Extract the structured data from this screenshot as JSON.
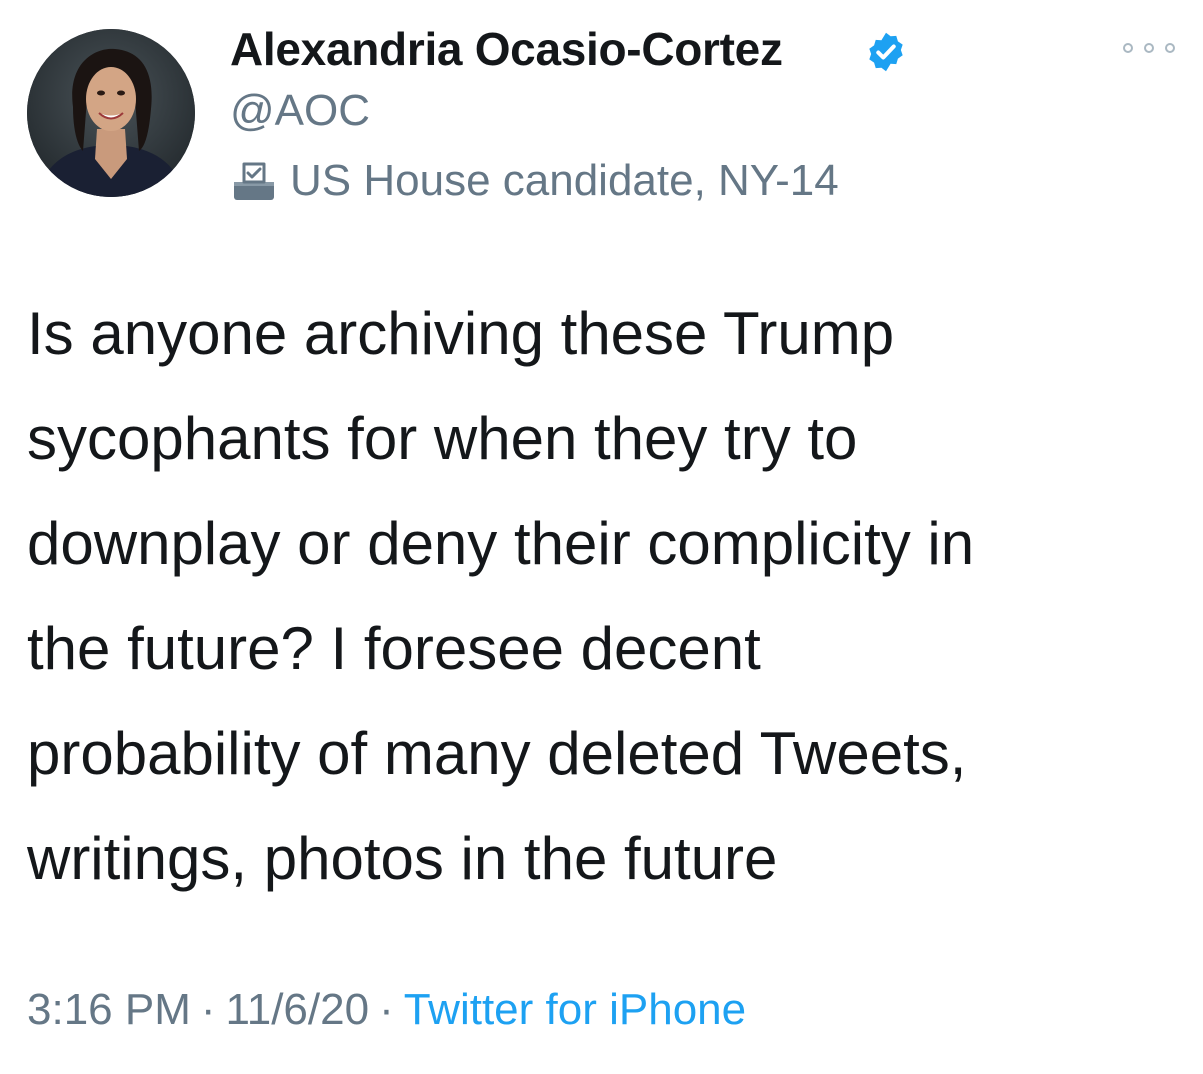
{
  "author": {
    "name": "Alexandria Ocasio-Cortez",
    "handle": "@AOC",
    "label": "US House candidate, NY-14",
    "verified": true
  },
  "tweet": {
    "lines": [
      "Is anyone archiving these Trump",
      "sycophants for when they try to",
      "downplay or deny their complicity in",
      "the future? I foresee decent",
      "probability of many deleted Tweets,",
      "writings, photos in the future"
    ]
  },
  "meta": {
    "time": "3:16 PM",
    "date": "11/6/20",
    "separator": "·",
    "source": "Twitter for iPhone"
  },
  "icons": {
    "verified": "verified-badge-icon",
    "label": "ballot-box-icon",
    "more": "more-options-icon"
  },
  "colors": {
    "text": "#14171a",
    "secondary": "#657786",
    "accent": "#1da1f2"
  }
}
